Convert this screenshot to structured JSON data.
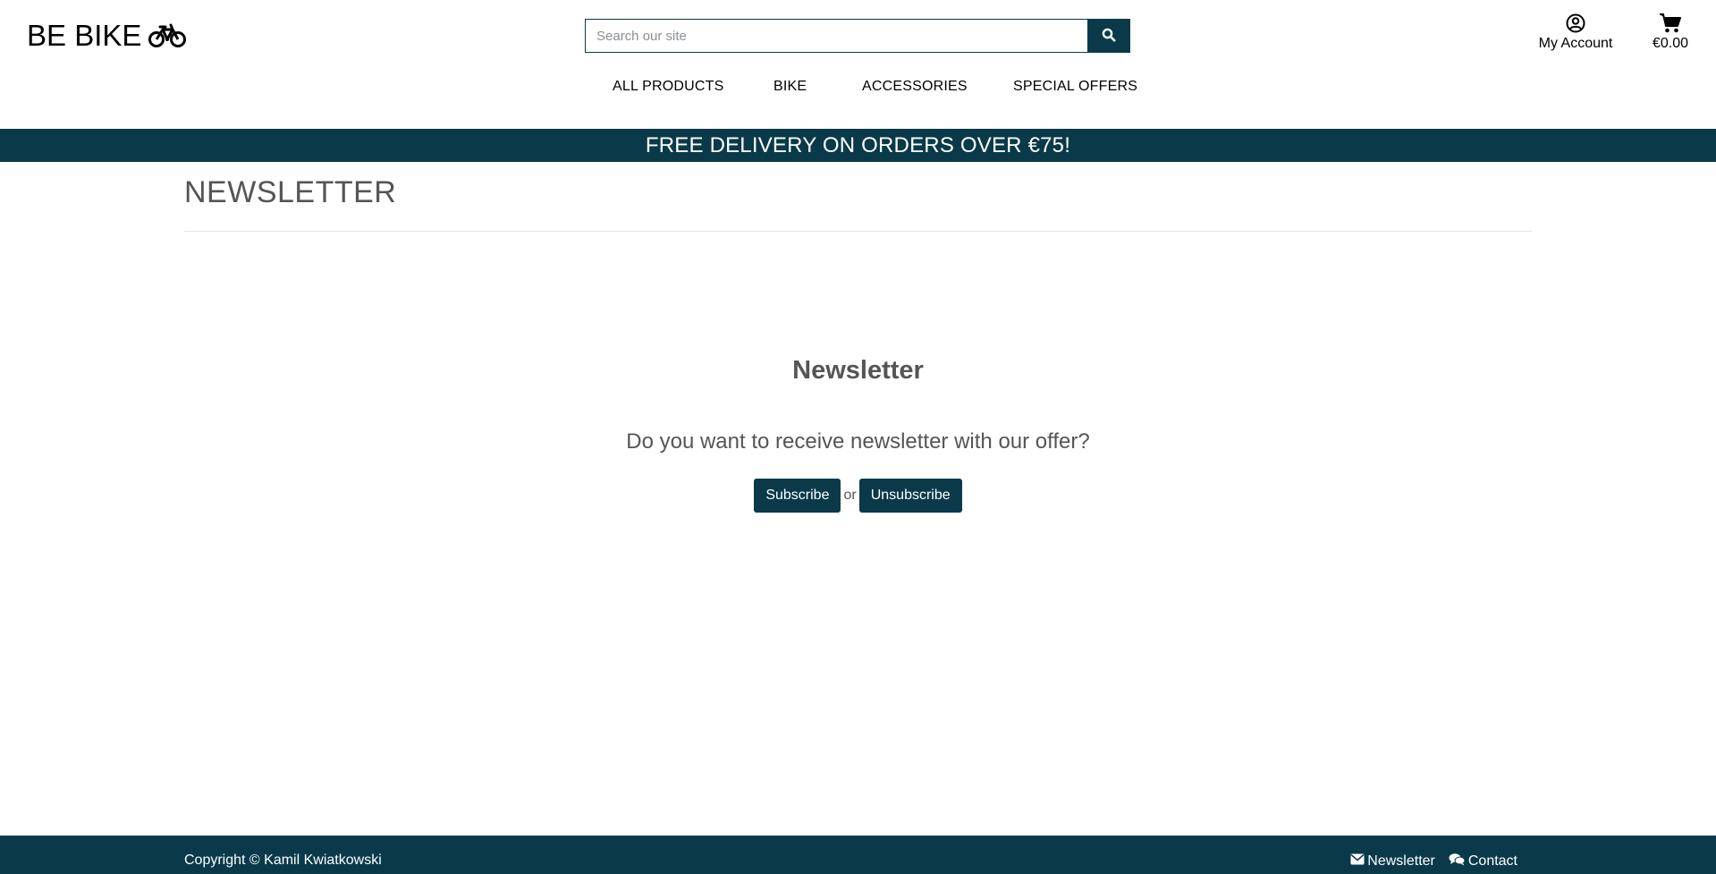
{
  "header": {
    "logo_text": "BE BIKE",
    "logo_icon": "bicycle-icon",
    "search": {
      "placeholder": "Search our site",
      "value": ""
    },
    "account_label": "My Account",
    "cart_total": "€0.00"
  },
  "nav": {
    "items": [
      {
        "label": "ALL PRODUCTS"
      },
      {
        "label": "BIKE"
      },
      {
        "label": "ACCESSORIES"
      },
      {
        "label": "SPECIAL OFFERS"
      }
    ]
  },
  "banner": {
    "text": "FREE DELIVERY ON ORDERS OVER €75!"
  },
  "main": {
    "page_title": "NEWSLETTER",
    "heading": "Newsletter",
    "question": "Do you want to receive newsletter with our offer?",
    "subscribe_label": "Subscribe",
    "or_text": "or",
    "unsubscribe_label": "Unsubscribe"
  },
  "footer": {
    "copyright": "Copyright © Kamil Kwiatkowski",
    "links": [
      {
        "label": "Newsletter",
        "icon": "envelope-icon"
      },
      {
        "label": "Contact",
        "icon": "comments-icon"
      }
    ]
  },
  "colors": {
    "brand": "#0a3a4a",
    "text_muted": "#555555"
  }
}
